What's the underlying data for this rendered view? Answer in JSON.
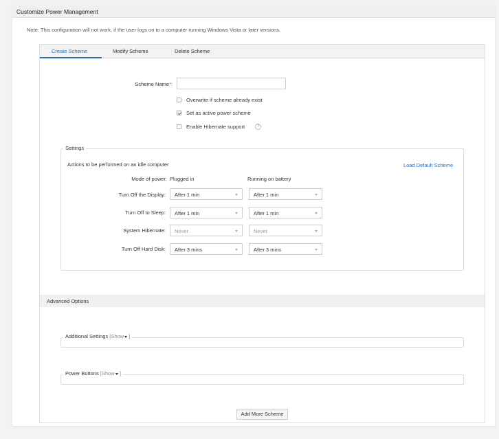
{
  "header": {
    "title": "Customize Power Management"
  },
  "note": "Note: This configuration will not work, if the user logs on to a computer running Windows Vista or later versions.",
  "tabs": [
    {
      "label": "Create Scheme",
      "active": true
    },
    {
      "label": "Modify Scheme",
      "active": false
    },
    {
      "label": "Delete Scheme",
      "active": false
    }
  ],
  "form": {
    "scheme_name_label": "Scheme Name",
    "scheme_name_required": "*",
    "scheme_name_colon": ":",
    "scheme_name_value": "",
    "checkboxes": [
      {
        "label": "Overwrite if scheme already exist",
        "checked": false
      },
      {
        "label": "Set as active power scheme",
        "checked": true
      },
      {
        "label": "Enable Hibernate support",
        "checked": false
      }
    ],
    "help_icon": "?"
  },
  "settings": {
    "legend": "Settings",
    "subtitle": "Actions to be performed on an idle computer",
    "load_default": "Load Default Scheme",
    "mode_label": "Mode of power:",
    "col_plugged": "Plugged in",
    "col_battery": "Running on battery",
    "rows": [
      {
        "label": "Turn Off the Display:",
        "plugged": "After 1 min",
        "battery": "After 1 min",
        "disabled": false
      },
      {
        "label": "Turn Off to Sleep:",
        "plugged": "After 1 min",
        "battery": "After 1 min",
        "disabled": false
      },
      {
        "label": "System Hibernate:",
        "plugged": "Never",
        "battery": "Never",
        "disabled": true
      },
      {
        "label": "Turn Off Hard Disk:",
        "plugged": "After 3 mins",
        "battery": "After 3 mins",
        "disabled": false
      }
    ]
  },
  "advanced": {
    "title": "Advanced Options",
    "additional_settings": "Additional Settings",
    "power_buttons": "Power Buttons",
    "show_label": "Show",
    "bracket_open": "[",
    "bracket_close": "]"
  },
  "add_button": "Add More Scheme"
}
